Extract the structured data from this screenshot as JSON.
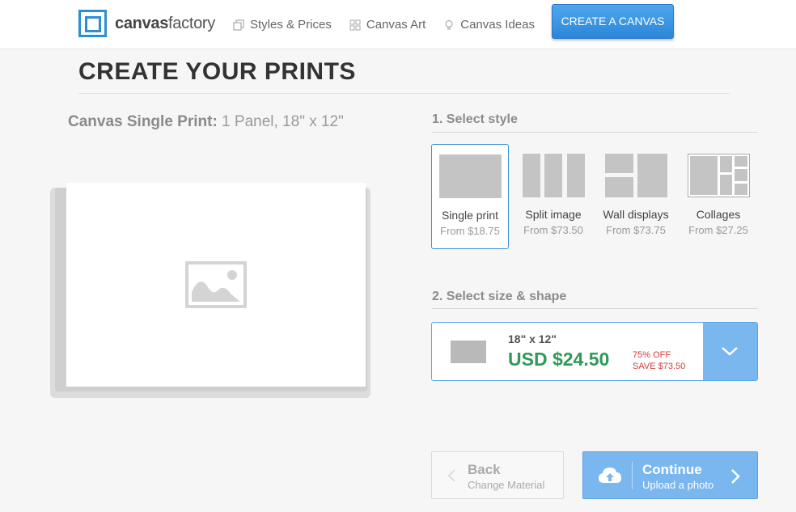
{
  "header": {
    "logo_bold": "canvas",
    "logo_light": "factory",
    "nav": [
      {
        "label": "Styles & Prices",
        "icon": "copy-icon"
      },
      {
        "label": "Canvas Art",
        "icon": "grid-icon"
      },
      {
        "label": "Canvas Ideas",
        "icon": "lightbulb-icon"
      }
    ],
    "cta_label": "CREATE A CANVAS"
  },
  "page_title": "CREATE YOUR PRINTS",
  "print_caption": {
    "bold": "Canvas Single Print:",
    "detail": " 1 Panel, 18\" x 12\""
  },
  "style_section": {
    "label": "1. Select style",
    "options": [
      {
        "name": "Single print",
        "price": "From $18.75",
        "selected": true
      },
      {
        "name": "Split image",
        "price": "From $73.50",
        "selected": false
      },
      {
        "name": "Wall displays",
        "price": "From $73.75",
        "selected": false
      },
      {
        "name": "Collages",
        "price": "From $27.25",
        "selected": false
      }
    ]
  },
  "size_section": {
    "label": "2. Select size & shape",
    "dimensions": "18\" x 12\"",
    "price": "USD $24.50",
    "discount": "75% OFF",
    "savings": "SAVE $73.50"
  },
  "actions": {
    "back_title": "Back",
    "back_sub": "Change Material",
    "continue_title": "Continue",
    "continue_sub": "Upload a photo"
  },
  "colors": {
    "accent": "#2b8fd1",
    "price_green": "#2e9a57",
    "discount_red": "#d23b3b",
    "button_blue": "#7ab7ee"
  }
}
